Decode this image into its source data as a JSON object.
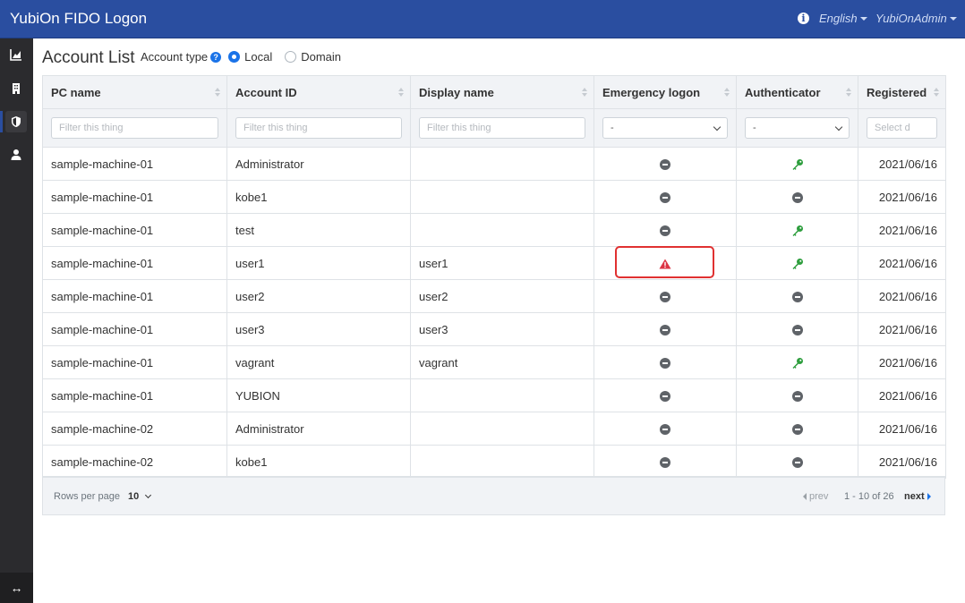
{
  "app": {
    "title": "YubiOn FIDO Logon"
  },
  "topbar": {
    "language": "English",
    "user": "YubiOnAdmin",
    "info_icon": "info-icon"
  },
  "sidebar": {
    "items": [
      {
        "icon": "chart-icon"
      },
      {
        "icon": "building-icon"
      },
      {
        "icon": "shield-icon"
      },
      {
        "icon": "user-icon"
      }
    ],
    "toggle_icon": "↔"
  },
  "page": {
    "title": "Account List",
    "account_type_label": "Account type",
    "options": {
      "local": "Local",
      "domain": "Domain"
    },
    "selected": "Local"
  },
  "table": {
    "headers": [
      "PC name",
      "Account ID",
      "Display name",
      "Emergency logon",
      "Authenticator",
      "Registered"
    ],
    "filters": {
      "text_placeholder": "Filter this thing",
      "select_value": "-",
      "date_placeholder": "Select d"
    },
    "rows": [
      {
        "pc": "sample-machine-01",
        "account": "Administrator",
        "display": "",
        "emergency": "disabled",
        "auth": "key",
        "registered": "2021/06/16"
      },
      {
        "pc": "sample-machine-01",
        "account": "kobe1",
        "display": "",
        "emergency": "disabled",
        "auth": "none",
        "registered": "2021/06/16"
      },
      {
        "pc": "sample-machine-01",
        "account": "test",
        "display": "",
        "emergency": "disabled",
        "auth": "key",
        "registered": "2021/06/16"
      },
      {
        "pc": "sample-machine-01",
        "account": "user1",
        "display": "user1",
        "emergency": "warning",
        "auth": "key",
        "registered": "2021/06/16"
      },
      {
        "pc": "sample-machine-01",
        "account": "user2",
        "display": "user2",
        "emergency": "disabled",
        "auth": "none",
        "registered": "2021/06/16"
      },
      {
        "pc": "sample-machine-01",
        "account": "user3",
        "display": "user3",
        "emergency": "disabled",
        "auth": "none",
        "registered": "2021/06/16"
      },
      {
        "pc": "sample-machine-01",
        "account": "vagrant",
        "display": "vagrant",
        "emergency": "disabled",
        "auth": "key",
        "registered": "2021/06/16"
      },
      {
        "pc": "sample-machine-01",
        "account": "YUBION",
        "display": "",
        "emergency": "disabled",
        "auth": "none",
        "registered": "2021/06/16"
      },
      {
        "pc": "sample-machine-02",
        "account": "Administrator",
        "display": "",
        "emergency": "disabled",
        "auth": "none",
        "registered": "2021/06/16"
      },
      {
        "pc": "sample-machine-02",
        "account": "kobe1",
        "display": "",
        "emergency": "disabled",
        "auth": "none",
        "registered": "2021/06/16"
      }
    ]
  },
  "pagination": {
    "rows_per_page_label": "Rows per page",
    "rows_per_page": "10",
    "prev": "prev",
    "range": "1 - 10 of 26",
    "next": "next"
  },
  "colors": {
    "topbar": "#2a4ea0",
    "sidebar": "#2b2b2e",
    "accent": "#1a73e8",
    "key": "#2e9e3e",
    "warning": "#dc3545",
    "highlight": "#e03131"
  }
}
